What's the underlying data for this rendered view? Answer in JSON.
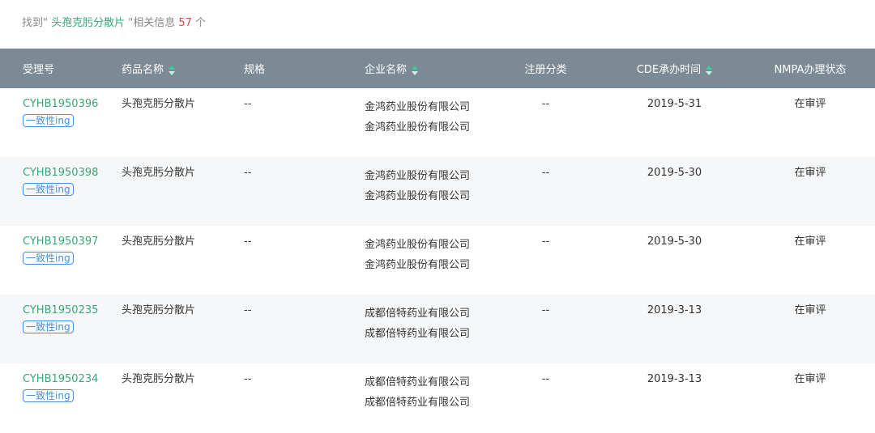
{
  "summary": {
    "prefix": "找到\" ",
    "keyword": "头孢克肟分散片",
    "middle": " \"相关信息 ",
    "count": "57",
    "suffix": " 个"
  },
  "columns": {
    "accept_no": "受理号",
    "drug_name": "药品名称",
    "spec": "规格",
    "company": "企业名称",
    "reg_class": "注册分类",
    "cde_time": "CDE承办时间",
    "nmpa_status": "NMPA办理状态"
  },
  "rows": [
    {
      "accept_no": "CYHB1950396",
      "badge": "一致性ing",
      "drug_name": "头孢克肟分散片",
      "spec": "--",
      "company": "金鸿药业股份有限公司 金鸿药业股份有限公司",
      "reg_class": "--",
      "cde_time": "2019-5-31",
      "nmpa_status": "在审评"
    },
    {
      "accept_no": "CYHB1950398",
      "badge": "一致性ing",
      "drug_name": "头孢克肟分散片",
      "spec": "--",
      "company": "金鸿药业股份有限公司 金鸿药业股份有限公司",
      "reg_class": "--",
      "cde_time": "2019-5-30",
      "nmpa_status": "在审评"
    },
    {
      "accept_no": "CYHB1950397",
      "badge": "一致性ing",
      "drug_name": "头孢克肟分散片",
      "spec": "--",
      "company": "金鸿药业股份有限公司 金鸿药业股份有限公司",
      "reg_class": "--",
      "cde_time": "2019-5-30",
      "nmpa_status": "在审评"
    },
    {
      "accept_no": "CYHB1950235",
      "badge": "一致性ing",
      "drug_name": "头孢克肟分散片",
      "spec": "--",
      "company": "成都倍特药业有限公司 成都倍特药业有限公司",
      "reg_class": "--",
      "cde_time": "2019-3-13",
      "nmpa_status": "在审评"
    },
    {
      "accept_no": "CYHB1950234",
      "badge": "一致性ing",
      "drug_name": "头孢克肟分散片",
      "spec": "--",
      "company": "成都倍特药业有限公司 成都倍特药业有限公司",
      "reg_class": "--",
      "cde_time": "2019-3-13",
      "nmpa_status": "在审评"
    }
  ],
  "colors": {
    "header_bg": "#7c8a95",
    "link": "#37a876",
    "count": "#e0454e",
    "badge": "#4a90d9",
    "sort_icon": "#41cba0"
  }
}
